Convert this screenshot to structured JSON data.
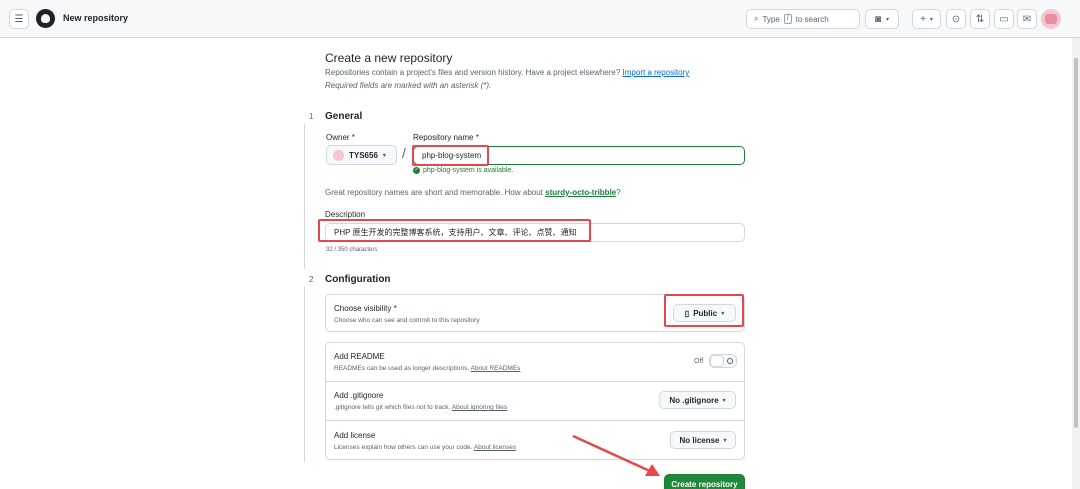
{
  "header": {
    "title": "New repository",
    "search_prefix": "Type",
    "search_key": "/",
    "search_suffix": "to search",
    "plus_label": "+",
    "caret": "▾"
  },
  "page": {
    "heading": "Create a new repository",
    "subtitle": "Repositories contain a project's files and version history. Have a project elsewhere?",
    "import_link": "Import a repository",
    "required_note": "Required fields are marked with an asterisk (*)."
  },
  "general": {
    "step": "1",
    "title": "General",
    "owner_label": "Owner *",
    "owner_value": "TYS656",
    "repo_label": "Repository name *",
    "repo_value": "php-blog-system",
    "available_text": "php-blog-system is available.",
    "hint_prefix": "Great repository names are short and memorable. How about",
    "hint_suggestion": "sturdy-octo-tribble",
    "hint_suffix": "?",
    "description_label": "Description",
    "description_value": "PHP 原生开发的完整博客系统，支持用户、文章、评论、点赞、通知",
    "counter": "32 / 350 characters"
  },
  "configuration": {
    "step": "2",
    "title": "Configuration",
    "visibility_title": "Choose visibility *",
    "visibility_desc": "Choose who can see and commit to this repository",
    "visibility_value": "Public",
    "readme_title": "Add README",
    "readme_desc": "READMEs can be used as longer descriptions.",
    "readme_link": "About READMEs",
    "readme_toggle_label": "Off",
    "gitignore_title": "Add .gitignore",
    "gitignore_desc": ".gitignore tells git which files not to track.",
    "gitignore_link": "About ignoring files",
    "gitignore_value": "No .gitignore",
    "license_title": "Add license",
    "license_desc": "Licenses explain how others can use your code.",
    "license_link": "About licenses",
    "license_value": "No license"
  },
  "actions": {
    "create_label": "Create repository"
  },
  "colors": {
    "accent": "#1f883d",
    "link": "#0969da",
    "highlight": "#e5474f",
    "success": "#1a7f37"
  },
  "icons": [
    "hamburger-icon",
    "github-logo-icon",
    "search-icon",
    "copilot-icon",
    "plus-icon",
    "issues-icon",
    "pull-requests-icon",
    "projects-icon",
    "inbox-icon",
    "repo-icon",
    "check-circle-icon",
    "chevron-down-icon"
  ]
}
